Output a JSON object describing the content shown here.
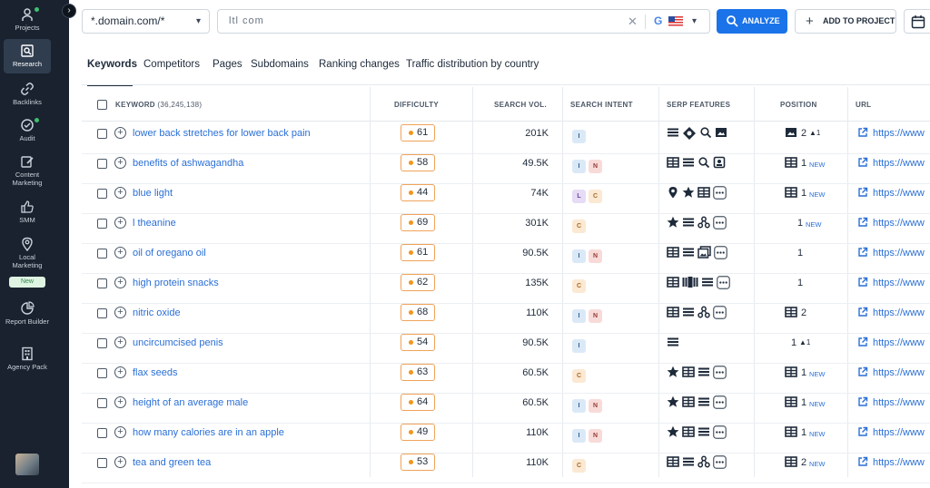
{
  "sidebar": {
    "items": [
      {
        "label": "Projects",
        "icon": "projects-icon",
        "dot": true
      },
      {
        "label": "Research",
        "icon": "research-icon",
        "active": true
      },
      {
        "label": "Backlinks",
        "icon": "link-icon"
      },
      {
        "label": "Audit",
        "icon": "audit-icon",
        "dot": true
      },
      {
        "label": "Content Marketing",
        "icon": "edit-icon"
      },
      {
        "label": "SMM",
        "icon": "thumb-up-icon"
      },
      {
        "label": "Local Marketing",
        "icon": "location-pin-icon"
      },
      {
        "label": "Report Builder",
        "icon": "pie-chart-icon"
      },
      {
        "label": "Agency Pack",
        "icon": "building-icon"
      }
    ],
    "new_badge": "New",
    "collapse_glyph": "›"
  },
  "topbar": {
    "domain_mode": "*.domain.com/*",
    "search_value": "ltl      com",
    "clear_glyph": "✕",
    "search_engine": "G",
    "analyze_label": "ANALYZE",
    "add_project_label": "ADD TO PROJECT"
  },
  "tabs": [
    "Keywords",
    "Competitors",
    "Pages",
    "Subdomains",
    "Ranking changes",
    "Traffic distribution by country"
  ],
  "table": {
    "headers": {
      "keyword": "KEYWORD",
      "keyword_count": "(36,245,138)",
      "difficulty": "DIFFICULTY",
      "search_vol": "SEARCH VOL.",
      "search_intent": "SEARCH INTENT",
      "serp_features": "SERP FEATURES",
      "position": "POSITION",
      "url": "URL"
    },
    "url_text": "https://www",
    "new_label": "NEW",
    "rows": [
      {
        "keyword": "lower back stretches for lower back pain",
        "difficulty": "61",
        "volume": "201K",
        "intents": [
          "I"
        ],
        "serp": [
          "list",
          "sitelinks",
          "search",
          "image"
        ],
        "pos_icon": "image",
        "position": "2",
        "change": "▲1",
        "is_new": false
      },
      {
        "keyword": "benefits of ashwagandha",
        "difficulty": "58",
        "volume": "49.5K",
        "intents": [
          "I",
          "N"
        ],
        "serp": [
          "table",
          "list",
          "search",
          "panel"
        ],
        "pos_icon": "table",
        "position": "1",
        "change": "",
        "is_new": true
      },
      {
        "keyword": "blue light",
        "difficulty": "44",
        "volume": "74K",
        "intents": [
          "L",
          "C"
        ],
        "serp": [
          "pin",
          "star",
          "table",
          "more"
        ],
        "pos_icon": "table",
        "position": "1",
        "change": "",
        "is_new": true
      },
      {
        "keyword": "l theanine",
        "difficulty": "69",
        "volume": "301K",
        "intents": [
          "C"
        ],
        "serp": [
          "star",
          "list",
          "related",
          "more"
        ],
        "pos_icon": "",
        "position": "1",
        "change": "",
        "is_new": true
      },
      {
        "keyword": "oil of oregano oil",
        "difficulty": "61",
        "volume": "90.5K",
        "intents": [
          "I",
          "N"
        ],
        "serp": [
          "table",
          "list",
          "gallery",
          "more"
        ],
        "pos_icon": "",
        "position": "1",
        "change": "",
        "is_new": false
      },
      {
        "keyword": "high protein snacks",
        "difficulty": "62",
        "volume": "135K",
        "intents": [
          "C"
        ],
        "serp": [
          "table",
          "carousel",
          "list",
          "more"
        ],
        "pos_icon": "",
        "position": "1",
        "change": "",
        "is_new": false
      },
      {
        "keyword": "nitric oxide",
        "difficulty": "68",
        "volume": "110K",
        "intents": [
          "I",
          "N"
        ],
        "serp": [
          "table",
          "list",
          "related",
          "more"
        ],
        "pos_icon": "table",
        "position": "2",
        "change": "",
        "is_new": false
      },
      {
        "keyword": "uncircumcised penis",
        "difficulty": "54",
        "volume": "90.5K",
        "intents": [
          "I"
        ],
        "serp": [
          "list"
        ],
        "pos_icon": "",
        "position": "1",
        "change": "▲1",
        "is_new": false
      },
      {
        "keyword": "flax seeds",
        "difficulty": "63",
        "volume": "60.5K",
        "intents": [
          "C"
        ],
        "serp": [
          "star",
          "table",
          "list",
          "more"
        ],
        "pos_icon": "table",
        "position": "1",
        "change": "",
        "is_new": true
      },
      {
        "keyword": "height of an average male",
        "difficulty": "64",
        "volume": "60.5K",
        "intents": [
          "I",
          "N"
        ],
        "serp": [
          "star",
          "table",
          "list",
          "more"
        ],
        "pos_icon": "table",
        "position": "1",
        "change": "",
        "is_new": true
      },
      {
        "keyword": "how many calories are in an apple",
        "difficulty": "49",
        "volume": "110K",
        "intents": [
          "I",
          "N"
        ],
        "serp": [
          "star",
          "table",
          "list",
          "more"
        ],
        "pos_icon": "table",
        "position": "1",
        "change": "",
        "is_new": true
      },
      {
        "keyword": "tea and green tea",
        "difficulty": "53",
        "volume": "110K",
        "intents": [
          "C"
        ],
        "serp": [
          "table",
          "list",
          "related",
          "more"
        ],
        "pos_icon": "table",
        "position": "2",
        "change": "",
        "is_new": true
      }
    ]
  },
  "colors": {
    "sidebar_bg": "#19222e",
    "accent_blue": "#1a73e8",
    "link_blue": "#2a6fd6",
    "difficulty_orange": "#f0951e"
  }
}
